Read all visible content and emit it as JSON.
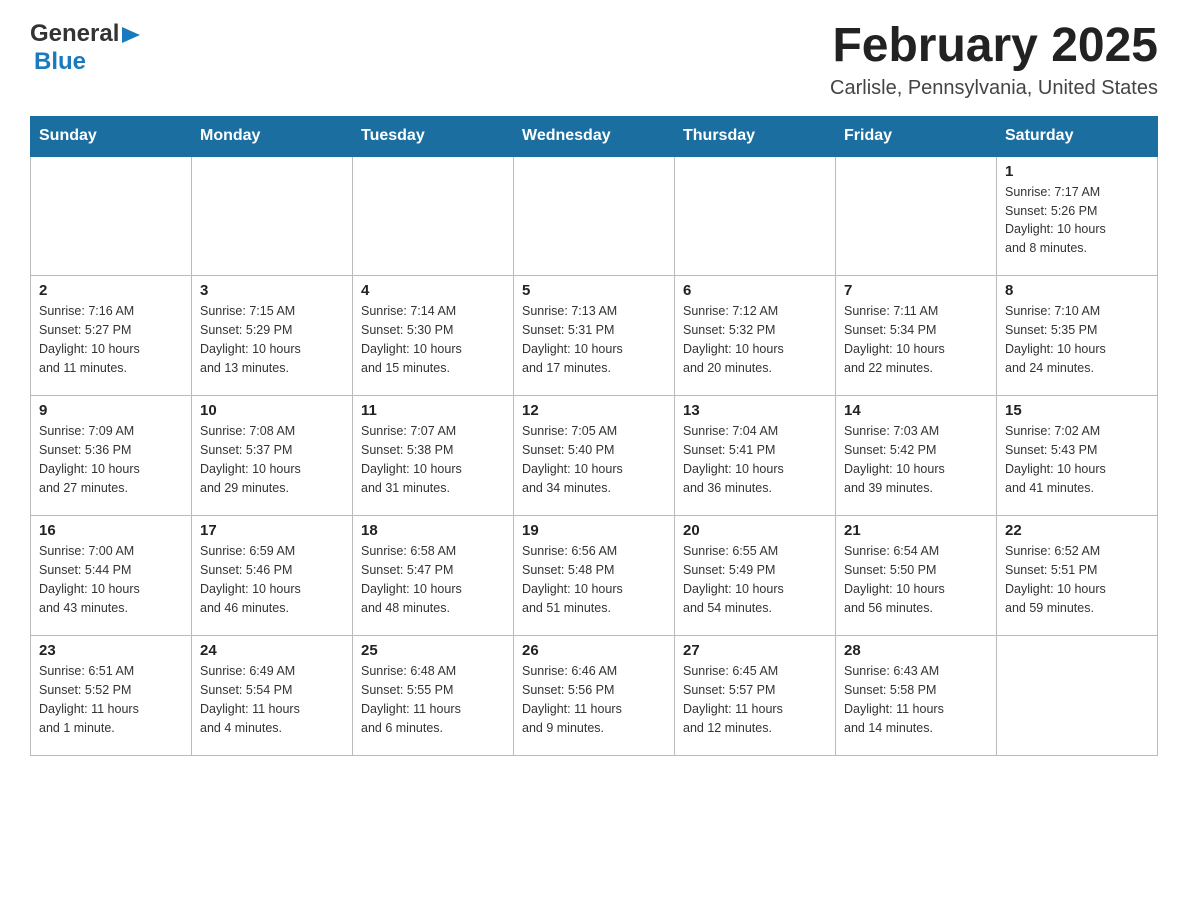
{
  "header": {
    "logo_general": "General",
    "logo_blue": "Blue",
    "month_title": "February 2025",
    "location": "Carlisle, Pennsylvania, United States"
  },
  "days_of_week": [
    "Sunday",
    "Monday",
    "Tuesday",
    "Wednesday",
    "Thursday",
    "Friday",
    "Saturday"
  ],
  "weeks": [
    [
      {
        "day": "",
        "info": ""
      },
      {
        "day": "",
        "info": ""
      },
      {
        "day": "",
        "info": ""
      },
      {
        "day": "",
        "info": ""
      },
      {
        "day": "",
        "info": ""
      },
      {
        "day": "",
        "info": ""
      },
      {
        "day": "1",
        "info": "Sunrise: 7:17 AM\nSunset: 5:26 PM\nDaylight: 10 hours\nand 8 minutes."
      }
    ],
    [
      {
        "day": "2",
        "info": "Sunrise: 7:16 AM\nSunset: 5:27 PM\nDaylight: 10 hours\nand 11 minutes."
      },
      {
        "day": "3",
        "info": "Sunrise: 7:15 AM\nSunset: 5:29 PM\nDaylight: 10 hours\nand 13 minutes."
      },
      {
        "day": "4",
        "info": "Sunrise: 7:14 AM\nSunset: 5:30 PM\nDaylight: 10 hours\nand 15 minutes."
      },
      {
        "day": "5",
        "info": "Sunrise: 7:13 AM\nSunset: 5:31 PM\nDaylight: 10 hours\nand 17 minutes."
      },
      {
        "day": "6",
        "info": "Sunrise: 7:12 AM\nSunset: 5:32 PM\nDaylight: 10 hours\nand 20 minutes."
      },
      {
        "day": "7",
        "info": "Sunrise: 7:11 AM\nSunset: 5:34 PM\nDaylight: 10 hours\nand 22 minutes."
      },
      {
        "day": "8",
        "info": "Sunrise: 7:10 AM\nSunset: 5:35 PM\nDaylight: 10 hours\nand 24 minutes."
      }
    ],
    [
      {
        "day": "9",
        "info": "Sunrise: 7:09 AM\nSunset: 5:36 PM\nDaylight: 10 hours\nand 27 minutes."
      },
      {
        "day": "10",
        "info": "Sunrise: 7:08 AM\nSunset: 5:37 PM\nDaylight: 10 hours\nand 29 minutes."
      },
      {
        "day": "11",
        "info": "Sunrise: 7:07 AM\nSunset: 5:38 PM\nDaylight: 10 hours\nand 31 minutes."
      },
      {
        "day": "12",
        "info": "Sunrise: 7:05 AM\nSunset: 5:40 PM\nDaylight: 10 hours\nand 34 minutes."
      },
      {
        "day": "13",
        "info": "Sunrise: 7:04 AM\nSunset: 5:41 PM\nDaylight: 10 hours\nand 36 minutes."
      },
      {
        "day": "14",
        "info": "Sunrise: 7:03 AM\nSunset: 5:42 PM\nDaylight: 10 hours\nand 39 minutes."
      },
      {
        "day": "15",
        "info": "Sunrise: 7:02 AM\nSunset: 5:43 PM\nDaylight: 10 hours\nand 41 minutes."
      }
    ],
    [
      {
        "day": "16",
        "info": "Sunrise: 7:00 AM\nSunset: 5:44 PM\nDaylight: 10 hours\nand 43 minutes."
      },
      {
        "day": "17",
        "info": "Sunrise: 6:59 AM\nSunset: 5:46 PM\nDaylight: 10 hours\nand 46 minutes."
      },
      {
        "day": "18",
        "info": "Sunrise: 6:58 AM\nSunset: 5:47 PM\nDaylight: 10 hours\nand 48 minutes."
      },
      {
        "day": "19",
        "info": "Sunrise: 6:56 AM\nSunset: 5:48 PM\nDaylight: 10 hours\nand 51 minutes."
      },
      {
        "day": "20",
        "info": "Sunrise: 6:55 AM\nSunset: 5:49 PM\nDaylight: 10 hours\nand 54 minutes."
      },
      {
        "day": "21",
        "info": "Sunrise: 6:54 AM\nSunset: 5:50 PM\nDaylight: 10 hours\nand 56 minutes."
      },
      {
        "day": "22",
        "info": "Sunrise: 6:52 AM\nSunset: 5:51 PM\nDaylight: 10 hours\nand 59 minutes."
      }
    ],
    [
      {
        "day": "23",
        "info": "Sunrise: 6:51 AM\nSunset: 5:52 PM\nDaylight: 11 hours\nand 1 minute."
      },
      {
        "day": "24",
        "info": "Sunrise: 6:49 AM\nSunset: 5:54 PM\nDaylight: 11 hours\nand 4 minutes."
      },
      {
        "day": "25",
        "info": "Sunrise: 6:48 AM\nSunset: 5:55 PM\nDaylight: 11 hours\nand 6 minutes."
      },
      {
        "day": "26",
        "info": "Sunrise: 6:46 AM\nSunset: 5:56 PM\nDaylight: 11 hours\nand 9 minutes."
      },
      {
        "day": "27",
        "info": "Sunrise: 6:45 AM\nSunset: 5:57 PM\nDaylight: 11 hours\nand 12 minutes."
      },
      {
        "day": "28",
        "info": "Sunrise: 6:43 AM\nSunset: 5:58 PM\nDaylight: 11 hours\nand 14 minutes."
      },
      {
        "day": "",
        "info": ""
      }
    ]
  ]
}
